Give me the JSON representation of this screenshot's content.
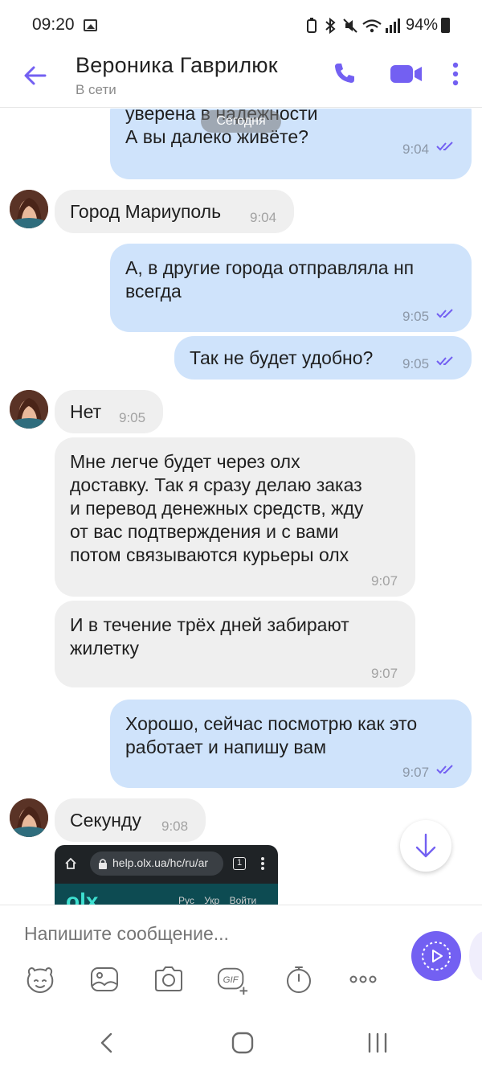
{
  "status_bar": {
    "time": "09:20",
    "battery": "94%",
    "icons": [
      "gallery-icon",
      "battery-saver-icon",
      "bluetooth-icon",
      "mute-icon",
      "wifi-icon",
      "signal-icon",
      "battery-icon"
    ]
  },
  "header": {
    "contact_name": "Вероника Гаврилюк",
    "status": "В сети",
    "accent_color": "#7360f2"
  },
  "chat": {
    "date_divider": "Сегодня",
    "messages": [
      {
        "direction": "out",
        "text": "уверена в надежности\nА вы далеко живёте?",
        "time": "9:04",
        "read": true
      },
      {
        "direction": "in",
        "text": "Город Мариуполь",
        "time": "9:04"
      },
      {
        "direction": "out",
        "text": "А, в другие города отправляла нп\nвсегда",
        "time": "9:05",
        "read": true
      },
      {
        "direction": "out",
        "text": "Так не будет удобно?",
        "time": "9:05",
        "read": true
      },
      {
        "direction": "in",
        "text": "Нет",
        "time": "9:05"
      },
      {
        "direction": "in",
        "text": "Мне легче будет через олх\nдоставку. Так я сразу делаю заказ\nи перевод денежных средств, жду\nот вас подтверждения и с вами\nпотом связываются курьеры олх",
        "time": "9:07"
      },
      {
        "direction": "in",
        "text": "И в течение трёх дней забирают\nжилетку",
        "time": "9:07"
      },
      {
        "direction": "out",
        "text": "Хорошо, сейчас посмотрю как это\nработает и напишу вам",
        "time": "9:07",
        "read": true
      },
      {
        "direction": "in",
        "text": "Секунду",
        "time": "9:08"
      }
    ],
    "link_preview": {
      "url": "help.olx.ua/hc/ru/ar",
      "logo": "olx",
      "links": [
        "Рус",
        "Укр",
        "Войти"
      ],
      "tab_count": "1"
    }
  },
  "composer": {
    "placeholder": "Напишите сообщение...",
    "tools": [
      "sticker-icon",
      "gallery-icon",
      "camera-icon",
      "gif-icon",
      "timer-icon",
      "more-icon"
    ]
  },
  "colors": {
    "outgoing_bubble": "#cfe3fb",
    "incoming_bubble": "#efefef",
    "read_ticks": "#7360f2"
  }
}
